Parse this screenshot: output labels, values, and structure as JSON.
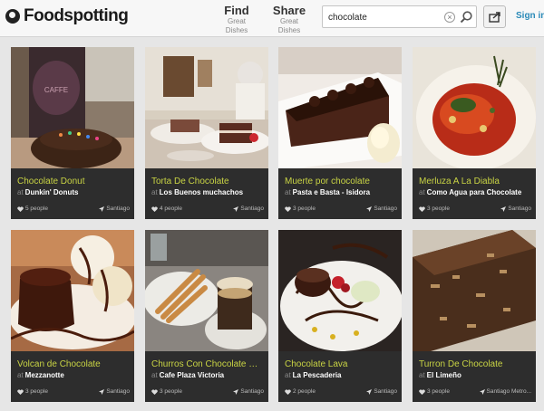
{
  "header": {
    "logo_text": "Foodspotting",
    "nav": [
      {
        "title": "Find",
        "subtitle": "Great Dishes"
      },
      {
        "title": "Share",
        "subtitle": "Great Dishes"
      }
    ],
    "search": {
      "value": "chocolate",
      "placeholder": ""
    },
    "sign_in": "Sign in"
  },
  "cards": [
    {
      "dish": "Chocolate Donut",
      "at": "at",
      "place": "Dunkin' Donuts",
      "people": "5 people",
      "location": "Santiago"
    },
    {
      "dish": "Torta De Chocolate",
      "at": "at",
      "place": "Los Buenos muchachos",
      "people": "4 people",
      "location": "Santiago"
    },
    {
      "dish": "Muerte por chocolate",
      "at": "at",
      "place": "Pasta e Basta - Isidora",
      "people": "3 people",
      "location": "Santiago"
    },
    {
      "dish": "Merluza A La Diabla",
      "at": "at",
      "place": "Como Agua para Chocolate",
      "people": "3 people",
      "location": "Santiago"
    },
    {
      "dish": "Volcan de Chocolate",
      "at": "at",
      "place": "Mezzanotte",
      "people": "3 people",
      "location": "Santiago"
    },
    {
      "dish": "Churros Con Chocolate Caliente",
      "at": "at",
      "place": "Cafe Plaza Victoria",
      "people": "3 people",
      "location": "Santiago"
    },
    {
      "dish": "Chocolate Lava",
      "at": "at",
      "place": "La Pescaderia",
      "people": "2 people",
      "location": "Santiago"
    },
    {
      "dish": "Turron De Chocolate",
      "at": "at",
      "place": "El Limeño",
      "people": "3 people",
      "location": "Santiago Metro..."
    }
  ],
  "icons": {
    "logo": "foodspotting-logo-icon",
    "clear": "clear-search-icon",
    "search": "search-icon",
    "share": "share-icon",
    "people": "heart-icon",
    "location": "location-arrow-icon"
  },
  "colors": {
    "dish_name": "#c9d444",
    "card_bg": "#2d2d2d",
    "sign_in": "#2a8ab8"
  }
}
